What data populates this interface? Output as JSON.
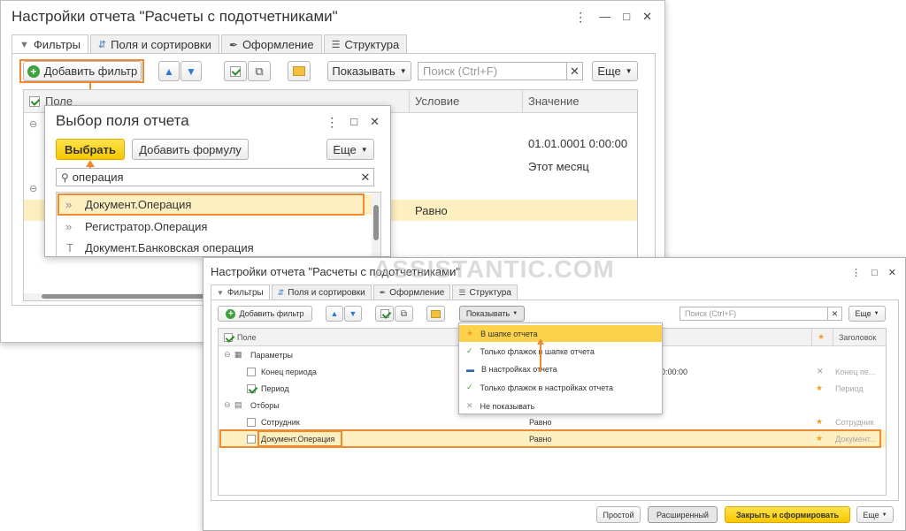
{
  "back": {
    "title": "Настройки отчета \"Расчеты с подотчетниками\"",
    "tabs": [
      {
        "label": "Фильтры",
        "icon": "funnel-icon"
      },
      {
        "label": "Поля и сортировки",
        "icon": "sort-icon"
      },
      {
        "label": "Оформление",
        "icon": "brush-icon"
      },
      {
        "label": "Структура",
        "icon": "structure-icon"
      }
    ],
    "toolbar": {
      "add_filter": "Добавить фильтр",
      "show": "Показывать",
      "search_placeholder": "Поиск (Ctrl+F)",
      "more": "Еще"
    },
    "columns": [
      "Поле",
      "Условие",
      "Значение"
    ],
    "rows": [
      {
        "condition": "",
        "value": "01.01.0001 0:00:00"
      },
      {
        "condition": "",
        "value": "Этот месяц"
      },
      {
        "condition": "Равно",
        "value": ""
      }
    ]
  },
  "picker": {
    "title": "Выбор поля отчета",
    "select": "Выбрать",
    "add_formula": "Добавить формулу",
    "more": "Еще",
    "search_value": "операция",
    "items": [
      {
        "label": "Документ.Операция",
        "icon": "double-chevron-icon"
      },
      {
        "label": "Регистратор.Операция",
        "icon": "double-chevron-icon"
      },
      {
        "label": "Документ.Банковская операция",
        "icon": "text-t-icon"
      }
    ]
  },
  "front": {
    "title": "Настройки отчета \"Расчеты с подотчетниками\"",
    "watermark": "ASSISTANTIC.COM",
    "tabs": [
      {
        "label": "Фильтры"
      },
      {
        "label": "Поля и сортировки"
      },
      {
        "label": "Оформление"
      },
      {
        "label": "Структура"
      }
    ],
    "toolbar": {
      "add_filter": "Добавить фильтр",
      "show": "Показывать",
      "search_placeholder": "Поиск (Ctrl+F)",
      "more": "Еще"
    },
    "columns": {
      "field": "Поле",
      "header": "Заголовок"
    },
    "menu": [
      {
        "label": "В шапке отчета",
        "icon": "star-icon"
      },
      {
        "label": "Только флажок в шапке отчета",
        "icon": "check-star-icon"
      },
      {
        "label": "В настройках отчета",
        "icon": "dash-icon"
      },
      {
        "label": "Только флажок в настройках отчета",
        "icon": "check-gear-icon"
      },
      {
        "label": "Не показывать",
        "icon": "cross-icon"
      }
    ],
    "rows": [
      {
        "label": "Параметры",
        "condition": "",
        "value": "",
        "header": ""
      },
      {
        "label": "Конец периода",
        "condition": "",
        "value": "0:00:00",
        "header": "Конец пе..."
      },
      {
        "label": "Период",
        "condition": "",
        "value": "",
        "header": "Период"
      },
      {
        "label": "Отборы",
        "condition": "",
        "value": "",
        "header": ""
      },
      {
        "label": "Сотрудник",
        "condition": "Равно",
        "value": "",
        "header": "Сотрудник"
      },
      {
        "label": "Документ.Операция",
        "condition": "Равно",
        "value": "",
        "header": "Документ..."
      }
    ],
    "footer": {
      "simple": "Простой",
      "advanced": "Расширенный",
      "close_build": "Закрыть и сформировать",
      "more": "Еще"
    }
  }
}
